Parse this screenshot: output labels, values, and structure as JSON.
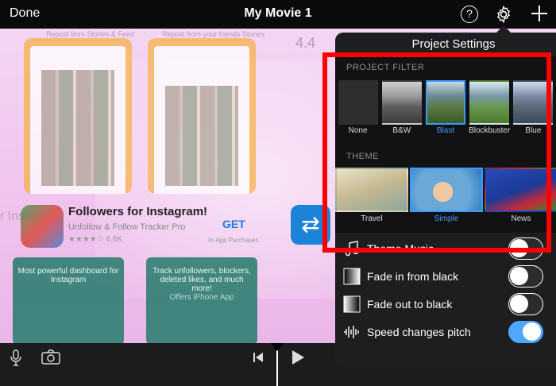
{
  "topbar": {
    "done_label": "Done",
    "title": "My Movie 1",
    "help_glyph": "?"
  },
  "background_viewer": {
    "bg_tag_left": "Repost from Stories & Feed",
    "bg_tag_right": "Repost from your friends Stories",
    "rating_snippet": "4.4",
    "insta_fragment": "r Insta",
    "app_title": "Followers for Instagram!",
    "app_subtitle": "Unfollow & Follow Tracker Pro",
    "app_ratings": "★★★★☆ 6.6K",
    "get_label": "GET",
    "in_app": "In-App Purchases",
    "card1": "Most powerful dashboard for Instagram",
    "card2": "Track unfollowers, blockers, deleted likes, and much more!",
    "card2_extra": "Offers iPhone App"
  },
  "settings": {
    "header": "Project Settings",
    "filter_section": "PROJECT FILTER",
    "filters": [
      {
        "label": "None",
        "icon": "none-swatch"
      },
      {
        "label": "B&W",
        "icon": "bw-swatch"
      },
      {
        "label": "Blast",
        "icon": "blast-swatch",
        "selected": true
      },
      {
        "label": "Blockbuster",
        "icon": "blockbuster-swatch"
      },
      {
        "label": "Blue",
        "icon": "blue-swatch"
      }
    ],
    "theme_section": "THEME",
    "themes": [
      {
        "label": "Travel",
        "icon": "travel-theme"
      },
      {
        "label": "Simple",
        "icon": "simple-theme",
        "selected": true
      },
      {
        "label": "News",
        "icon": "news-theme"
      }
    ],
    "options": [
      {
        "label": "Theme Music",
        "icon": "music-note-icon",
        "on": false
      },
      {
        "label": "Fade in from black",
        "icon": "fade-in-icon",
        "on": false
      },
      {
        "label": "Fade out to black",
        "icon": "fade-out-icon",
        "on": false
      },
      {
        "label": "Speed changes pitch",
        "icon": "waveform-icon",
        "on": true
      }
    ]
  },
  "colors": {
    "accent": "#3d9bff",
    "highlight_box": "#ff0000",
    "toggle_on": "#4ea8ff"
  }
}
